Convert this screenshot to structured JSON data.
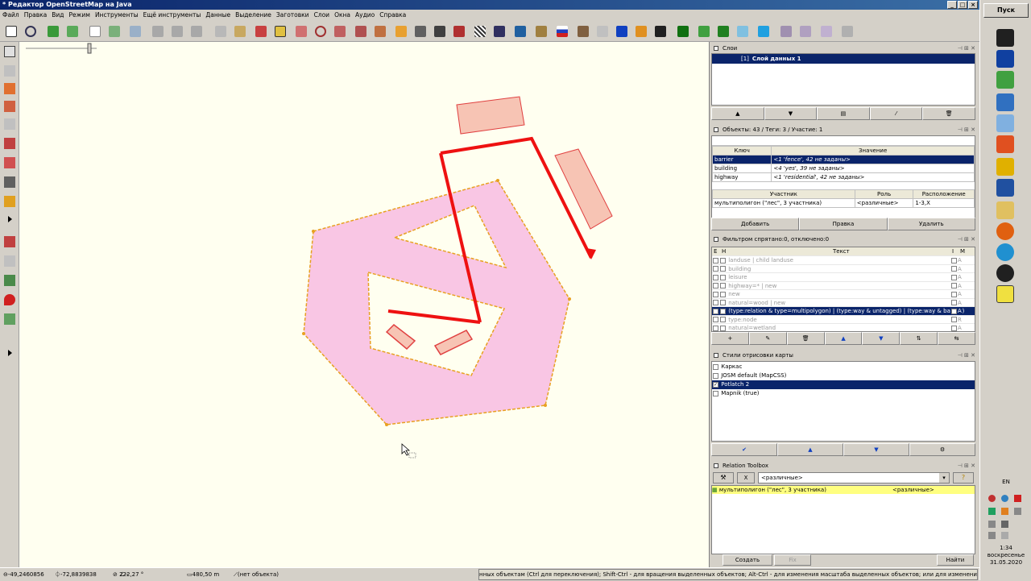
{
  "window": {
    "title": "* Редактор OpenStreetMap на Java"
  },
  "menu": [
    "Файл",
    "Правка",
    "Вид",
    "Режим",
    "Инструменты",
    "Ещё инструменты",
    "Данные",
    "Выделение",
    "Заготовки",
    "Слои",
    "Окна",
    "Аудио",
    "Справка"
  ],
  "layers": {
    "header": "Слои",
    "layer_index": "[1]",
    "layer_name": "Слой данных 1"
  },
  "tags": {
    "header": "Объекты: 43 / Теги: 3 / Участие: 1",
    "col_key": "Ключ",
    "col_value": "Значение",
    "rows": [
      {
        "key": "barrier",
        "value": "<1 'fence', 42 не заданы>"
      },
      {
        "key": "building",
        "value": "<4 'yes', 39 не заданы>"
      },
      {
        "key": "highway",
        "value": "<1 'residential', 42 не заданы>"
      }
    ],
    "col_member": "Участник",
    "col_role": "Роль",
    "col_position": "Расположение",
    "member": {
      "name": "мультиполигон (\"лес\", 3 участника)",
      "role": "<различные>",
      "position": "1-3,X"
    },
    "add": "Добавить",
    "edit": "Правка",
    "delete": "Удалить"
  },
  "filter": {
    "header": "Фильтром спрятано:0, отключено:0",
    "col_e": "E",
    "col_h": "H",
    "col_text": "Текст",
    "col_i": "I",
    "col_m": "M",
    "rows": [
      {
        "text": "landuse | child landuse",
        "mode": "A"
      },
      {
        "text": "building",
        "mode": "A"
      },
      {
        "text": "leisure",
        "mode": "A"
      },
      {
        "text": "highway=* | new",
        "mode": "A"
      },
      {
        "text": "new",
        "mode": "A"
      },
      {
        "text": "natural=wood | new",
        "mode": "A"
      },
      {
        "text": "(type:relation & type=multipolygon) | (type:way & untagged) | (type:way & barrier)",
        "mode": "A"
      },
      {
        "text": "type:node",
        "mode": "R"
      },
      {
        "text": "natural=wetland",
        "mode": "A"
      }
    ]
  },
  "styles": {
    "header": "Стили отрисовки карты",
    "items": [
      {
        "label": "Каркас",
        "checked": false
      },
      {
        "label": "JOSM default (MapCSS)",
        "checked": false
      },
      {
        "label": "Potlatch 2",
        "checked": true
      },
      {
        "label": "Mapnik (true)",
        "checked": false
      }
    ]
  },
  "relation_toolbox": {
    "header": "Relation Toolbox",
    "x_label": "X",
    "role_value": "<различные>",
    "relation": "мультиполигон (\"лес\", 3 участника)",
    "relation_role": "<различные>",
    "create": "Создать",
    "find": "Найти",
    "fix": "Fix"
  },
  "status": {
    "lat": "-49,2460856",
    "lon": "-72,8839838",
    "angle": "222,27 °",
    "angle_dash": "--",
    "length": "480,50 m",
    "object": "(нет объекта)",
    "hint": "нных объектам (Ctrl для переключения); Shift-Ctrl - для вращения выделенных объектов; Alt-Ctrl - для изменения масштаба выделенных объектов; или для изменения выделения"
  },
  "taskbar": {
    "start": "Пуск",
    "lang": "EN",
    "time": "1:34",
    "day": "воскресенье",
    "date": "31.05.2020"
  },
  "colors": {
    "map_bg": "#fffff0",
    "polygon_fill": "#f9c6e4",
    "polygon_edge": "#e8a020",
    "selected_way": "#ee1111",
    "building_fill": "#f7c4b4",
    "selection_blue": "#0a246a"
  }
}
